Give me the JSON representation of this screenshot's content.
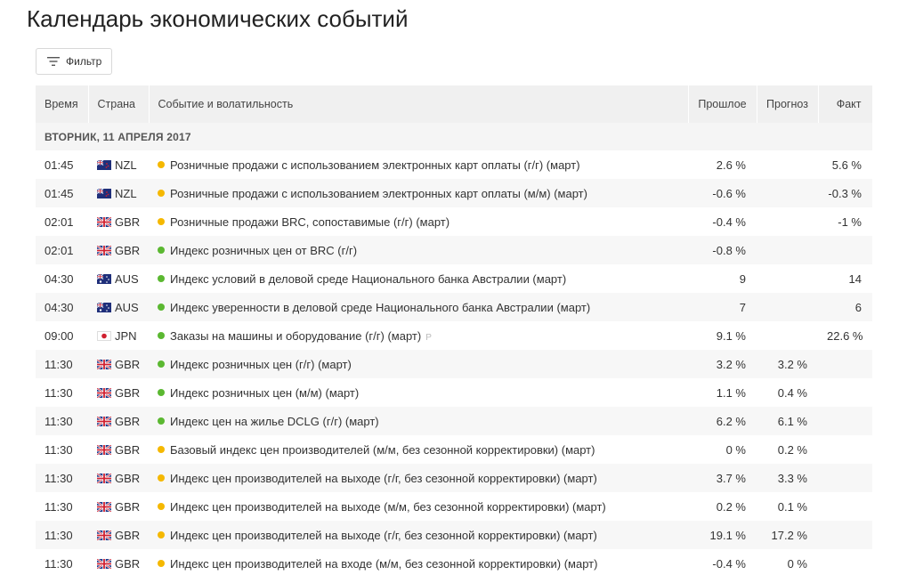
{
  "page_title": "Календарь экономических событий",
  "filter_label": "Фильтр",
  "columns": {
    "time": "Время",
    "country": "Страна",
    "event": "Событие и волатильность",
    "previous": "Прошлое",
    "forecast": "Прогноз",
    "actual": "Факт"
  },
  "date_header": "ВТОРНИК, 11 АПРЕЛЯ 2017",
  "colors": {
    "volatility_medium": "#f5b800",
    "volatility_low": "#5bb831"
  },
  "events": [
    {
      "time": "01:45",
      "flag": "nz-flag",
      "country": "NZL",
      "volatility": "medium",
      "event": "Розничные продажи с использованием электронных карт оплаты (г/г) (март)",
      "previous": "2.6 %",
      "forecast": "",
      "actual": "5.6 %"
    },
    {
      "time": "01:45",
      "flag": "nz-flag",
      "country": "NZL",
      "volatility": "medium",
      "event": "Розничные продажи с использованием электронных карт оплаты (м/м) (март)",
      "previous": "-0.6 %",
      "forecast": "",
      "actual": "-0.3 %"
    },
    {
      "time": "02:01",
      "flag": "gb-flag",
      "country": "GBR",
      "volatility": "medium",
      "event": "Розничные продажи BRC, сопоставимые (г/г) (март)",
      "previous": "-0.4 %",
      "forecast": "",
      "actual": "-1 %"
    },
    {
      "time": "02:01",
      "flag": "gb-flag",
      "country": "GBR",
      "volatility": "low",
      "event": "Индекс розничных цен от BRC (г/г)",
      "previous": "-0.8 %",
      "forecast": "",
      "actual": ""
    },
    {
      "time": "04:30",
      "flag": "au-flag",
      "country": "AUS",
      "volatility": "low",
      "event": "Индекс условий в деловой среде Национального банка Австралии (март)",
      "previous": "9",
      "forecast": "",
      "actual": "14"
    },
    {
      "time": "04:30",
      "flag": "au-flag",
      "country": "AUS",
      "volatility": "low",
      "event": "Индекс уверенности в деловой среде Национального банка Австралии (март)",
      "previous": "7",
      "forecast": "",
      "actual": "6"
    },
    {
      "time": "09:00",
      "flag": "jp-flag",
      "country": "JPN",
      "volatility": "low",
      "event": "Заказы на машины и оборудование (г/г) (март)",
      "prelim": "P",
      "previous": "9.1 %",
      "forecast": "",
      "actual": "22.6 %"
    },
    {
      "time": "11:30",
      "flag": "gb-flag",
      "country": "GBR",
      "volatility": "low",
      "event": "Индекс розничных цен (г/г) (март)",
      "previous": "3.2 %",
      "forecast": "3.2 %",
      "actual": ""
    },
    {
      "time": "11:30",
      "flag": "gb-flag",
      "country": "GBR",
      "volatility": "low",
      "event": "Индекс розничных цен (м/м) (март)",
      "previous": "1.1 %",
      "forecast": "0.4 %",
      "actual": ""
    },
    {
      "time": "11:30",
      "flag": "gb-flag",
      "country": "GBR",
      "volatility": "low",
      "event": "Индекс цен на жилье DCLG (г/г) (март)",
      "previous": "6.2 %",
      "forecast": "6.1 %",
      "actual": ""
    },
    {
      "time": "11:30",
      "flag": "gb-flag",
      "country": "GBR",
      "volatility": "medium",
      "event": "Базовый индекс цен производителей (м/м, без сезонной корректировки) (март)",
      "previous": "0 %",
      "forecast": "0.2 %",
      "actual": ""
    },
    {
      "time": "11:30",
      "flag": "gb-flag",
      "country": "GBR",
      "volatility": "medium",
      "event": "Индекс цен производителей на выходе (г/г, без сезонной корректировки) (март)",
      "previous": "3.7 %",
      "forecast": "3.3 %",
      "actual": ""
    },
    {
      "time": "11:30",
      "flag": "gb-flag",
      "country": "GBR",
      "volatility": "medium",
      "event": "Индекс цен производителей на выходе (м/м, без сезонной корректировки) (март)",
      "previous": "0.2 %",
      "forecast": "0.1 %",
      "actual": ""
    },
    {
      "time": "11:30",
      "flag": "gb-flag",
      "country": "GBR",
      "volatility": "medium",
      "event": "Индекс цен производителей на выходе (г/г, без сезонной корректировки) (март)",
      "previous": "19.1 %",
      "forecast": "17.2 %",
      "actual": ""
    },
    {
      "time": "11:30",
      "flag": "gb-flag",
      "country": "GBR",
      "volatility": "medium",
      "event": "Индекс цен производителей на входе (м/м, без сезонной корректировки) (март)",
      "previous": "-0.4 %",
      "forecast": "0 %",
      "actual": ""
    }
  ]
}
